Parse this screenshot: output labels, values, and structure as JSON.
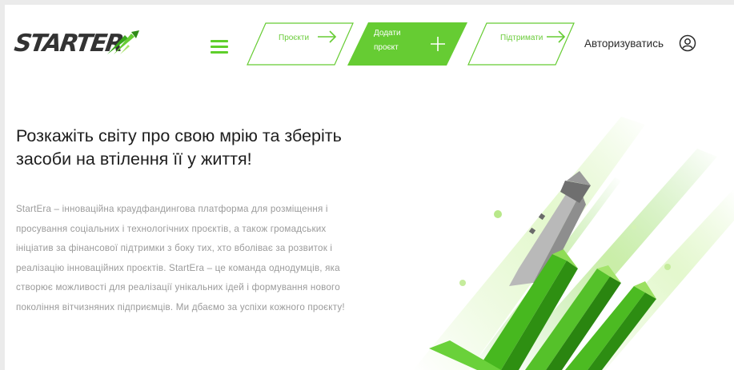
{
  "header": {
    "logo_text": "STARTER",
    "menu_icon": "hamburger-icon",
    "nav": {
      "projects_label": "Проєкти",
      "add_project_label": "Додати проєкт",
      "support_label": "Підтримати"
    },
    "auth_label": "Авторизуватись",
    "user_icon": "user-circle-icon"
  },
  "hero": {
    "title": "Розкажіть світу про свою мрію та зберіть засоби на втілення її у життя!",
    "description": "StartEra – інноваційна краудфандингова платформа для розміщення і просування соціальних і технологічних проєктів, а також громадських ініціатив за фінансової підтримки з боку тих, хто вболіває за розвиток і реалізацію інноваційних проєктів. StartEra – це команда однодумців, яка створює можливості для реалізації унікальних ідей і формування нового покоління вітчизняних підприємців. Ми дбаємо за успіхи кожного проєкту!"
  },
  "colors": {
    "accent": "#66cc33",
    "accent_dark": "#3aa81c",
    "text_dark": "#1e1e1e",
    "text_muted": "#9a9a9a"
  }
}
